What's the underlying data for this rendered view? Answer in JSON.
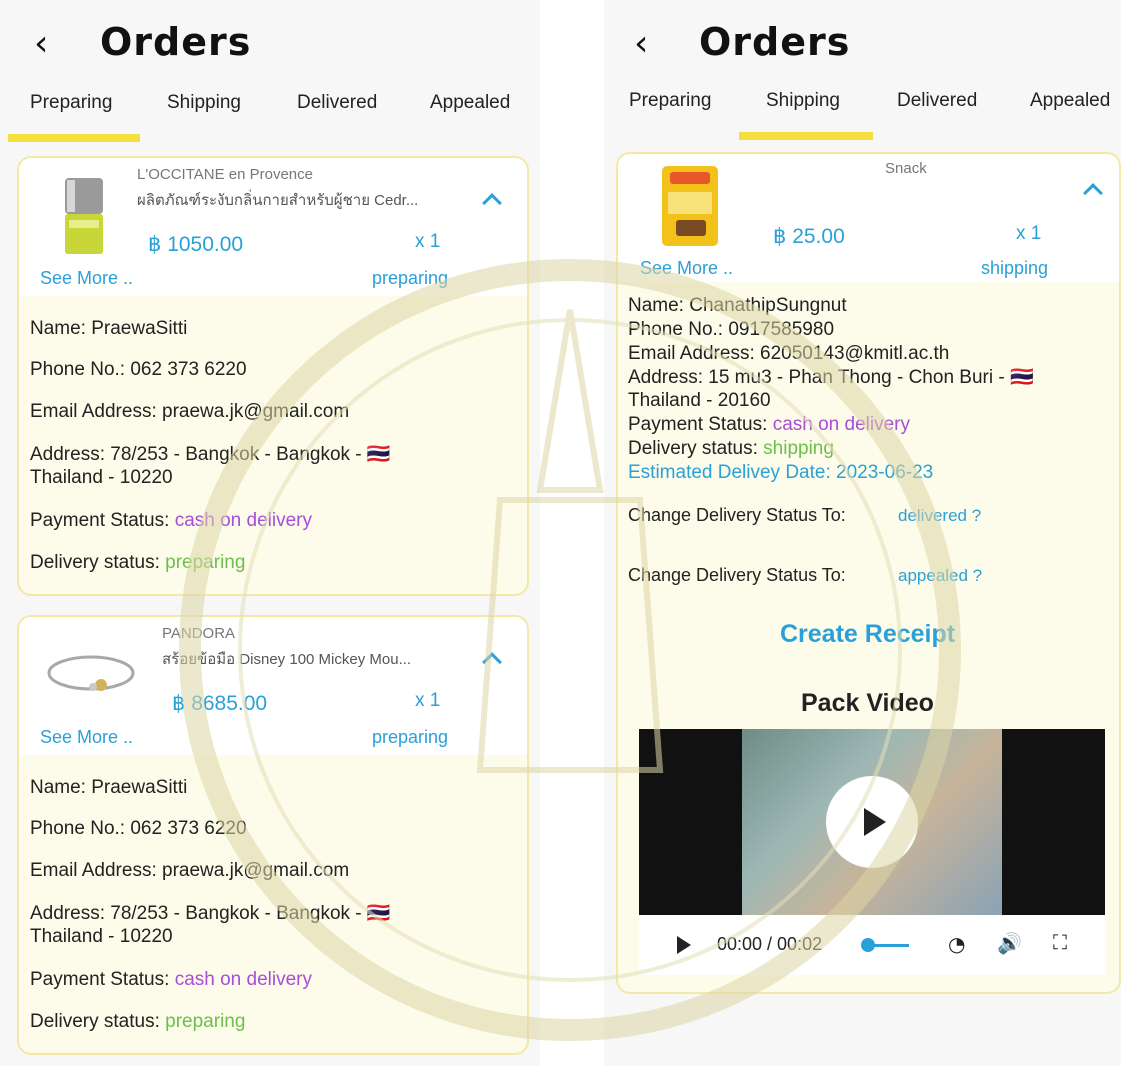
{
  "colors": {
    "accent_blue": "#2aa0d8",
    "purple": "#a64ed8",
    "green": "#6cc04a",
    "tab_indicator": "#f5e040",
    "card_bg": "#fdfbe9",
    "card_border": "#f3e9a6"
  },
  "left": {
    "header": {
      "back_icon": "‹",
      "title": "Orders"
    },
    "tabs": [
      "Preparing",
      "Shipping",
      "Delivered",
      "Appealed"
    ],
    "active_tab": "Preparing",
    "orders": [
      {
        "brand": "L'OCCITANE en Provence",
        "product": "ผลิตภัณฑ์ระงับกลิ่นกายสำหรับผู้ชาย Cedr...",
        "price": "฿ 1050.00",
        "qty": "x 1",
        "see_more": "See More ..",
        "status": "preparing",
        "name": "Name: PraewaSitti",
        "phone": "Phone No.: 062 373 6220",
        "email": "Email Address: praewa.jk@gmail.com",
        "address_line1": "Address: 78/253 - Bangkok - Bangkok - 🇹🇭",
        "address_line2": "Thailand - 10220",
        "payment_label": "Payment Status: ",
        "payment_value": "cash on delivery",
        "delivery_label": "Delivery status: ",
        "delivery_value": "preparing"
      },
      {
        "brand": "PANDORA",
        "product": "สร้อยข้อมือ Disney 100 Mickey Mou...",
        "price": "฿ 8685.00",
        "qty": "x 1",
        "see_more": "See More ..",
        "status": "preparing",
        "name": "Name: PraewaSitti",
        "phone": "Phone No.: 062 373 6220",
        "email": "Email Address: praewa.jk@gmail.com",
        "address_line1": "Address: 78/253 - Bangkok - Bangkok - 🇹🇭",
        "address_line2": "Thailand - 10220",
        "payment_label": "Payment Status: ",
        "payment_value": "cash on delivery",
        "delivery_label": "Delivery status: ",
        "delivery_value": "preparing"
      }
    ]
  },
  "right": {
    "header": {
      "back_icon": "‹",
      "title": "Orders"
    },
    "tabs": [
      "Preparing",
      "Shipping",
      "Delivered",
      "Appealed"
    ],
    "active_tab": "Shipping",
    "order": {
      "brand": "Snack",
      "price": "฿ 25.00",
      "qty": "x 1",
      "see_more": "See More ..",
      "status": "shipping",
      "name": "Name: ChanathipSungnut",
      "phone": "Phone No.: 0917585980",
      "email": "Email Address: 62050143@kmitl.ac.th",
      "address_line1": "Address: 15 mu3 - Phan Thong - Chon Buri - 🇹🇭",
      "address_line2": "Thailand - 20160",
      "payment_label": "Payment Status: ",
      "payment_value": "cash on delivery",
      "delivery_label": "Delivery status: ",
      "delivery_value": "shipping",
      "estimated": "Estimated Delivey Date: 2023-06-23",
      "change_label_1": "Change Delivery Status To:",
      "change_value_1": "delivered ?",
      "change_label_2": "Change Delivery Status To:",
      "change_value_2": "appealed ?",
      "create_receipt": "Create Receipt",
      "pack_video_title": "Pack Video",
      "video_time": "00:00 / 00:02",
      "video_progress": 0.0
    }
  }
}
